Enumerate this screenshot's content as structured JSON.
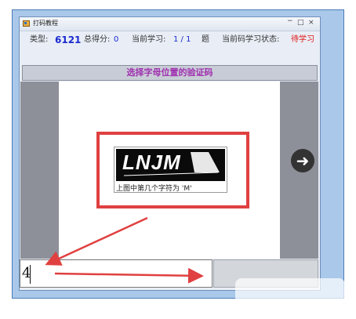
{
  "window": {
    "title": "打码教程",
    "controls": {
      "minimize": "−",
      "maximize": "□",
      "close": "×"
    }
  },
  "status": {
    "type_label": "类型:",
    "type_value": "6121",
    "score_label": "总得分:",
    "score_value": "0",
    "progress_label": "当前学习:",
    "progress_value": "1 / 1",
    "progress_suffix": "题",
    "learn_state_label": "当前码学习状态:",
    "learn_state_value": "待学习"
  },
  "header": {
    "instruction": "选择字母位置的验证码"
  },
  "captcha": {
    "image_text": "LNJM",
    "hint": "上图中第几个字符为 'M'"
  },
  "answer_input": {
    "value": "4"
  },
  "next_button": {
    "icon": "arrow-right-icon",
    "glyph": "➜"
  },
  "colors": {
    "annotation_red": "#e04040",
    "status_value_blue": "#1a2ad0",
    "status_pending_red": "#e01818",
    "header_text_purple": "#a030b0"
  }
}
